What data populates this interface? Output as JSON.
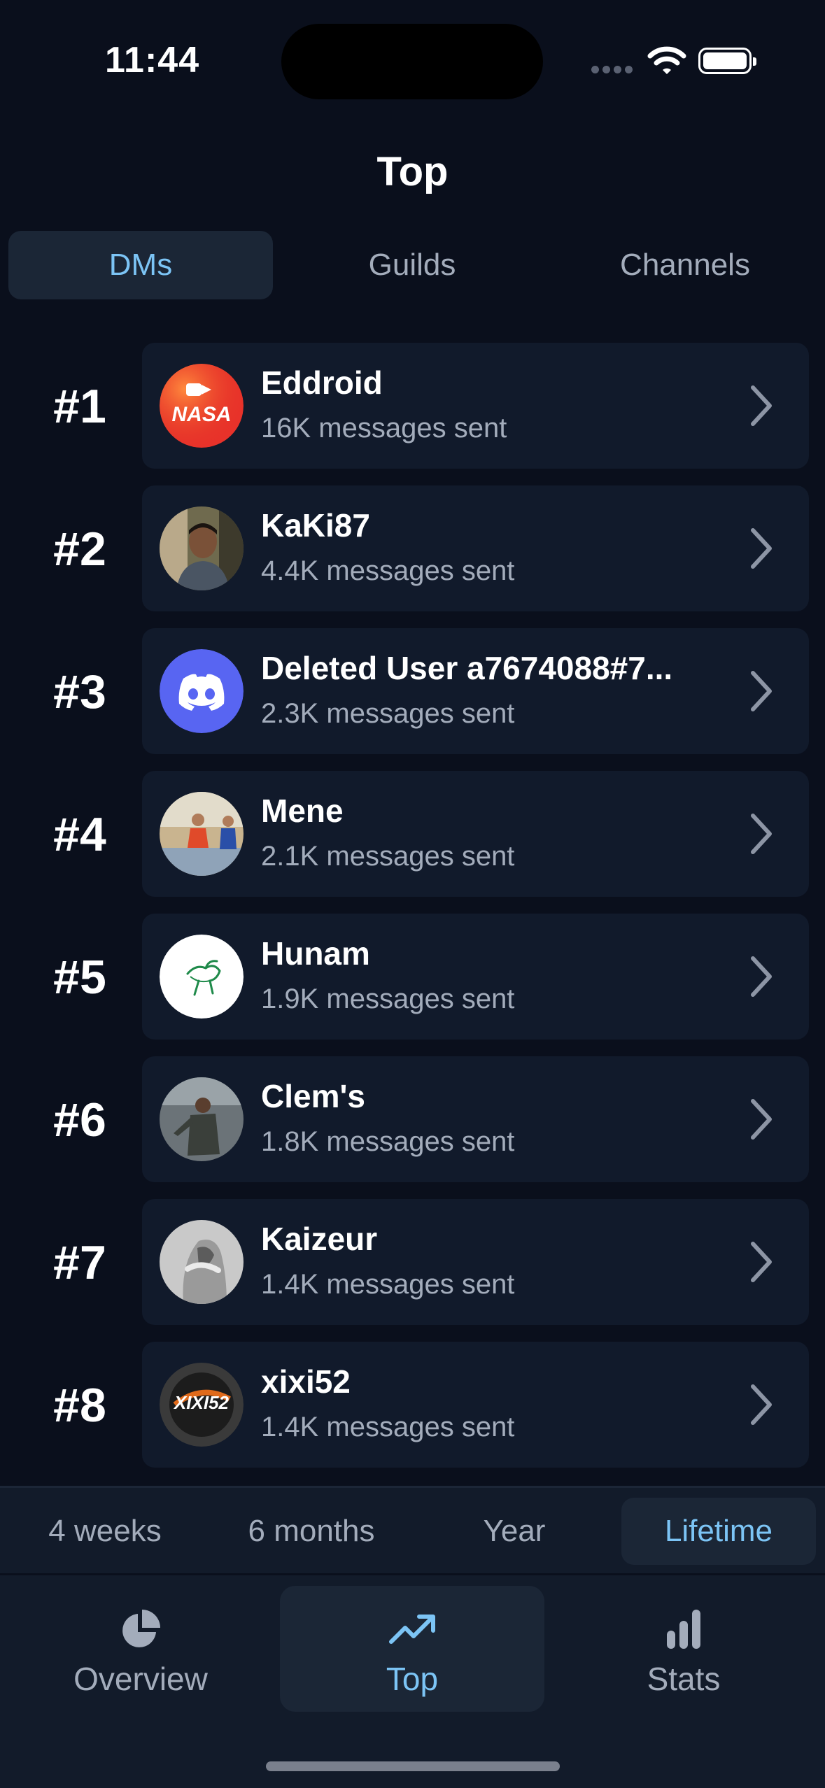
{
  "status": {
    "time": "11:44"
  },
  "header": {
    "title": "Top"
  },
  "segments": [
    {
      "label": "DMs",
      "active": true
    },
    {
      "label": "Guilds",
      "active": false
    },
    {
      "label": "Channels",
      "active": false
    }
  ],
  "rows": [
    {
      "rank": "#1",
      "name": "Eddroid",
      "sub": "16K messages sent",
      "avatar": "nasa-logo-avatar"
    },
    {
      "rank": "#2",
      "name": "KaKi87",
      "sub": "4.4K messages sent",
      "avatar": "person-photo-avatar"
    },
    {
      "rank": "#3",
      "name": "Deleted User a7674088#7...",
      "sub": "2.3K messages sent",
      "avatar": "discord-logo-avatar"
    },
    {
      "rank": "#4",
      "name": "Mene",
      "sub": "2.1K messages sent",
      "avatar": "sports-photo-avatar"
    },
    {
      "rank": "#5",
      "name": "Hunam",
      "sub": "1.9K messages sent",
      "avatar": "green-sketch-avatar"
    },
    {
      "rank": "#6",
      "name": "Clem's",
      "sub": "1.8K messages sent",
      "avatar": "movie-still-avatar"
    },
    {
      "rank": "#7",
      "name": "Kaizeur",
      "sub": "1.4K messages sent",
      "avatar": "hooded-figure-avatar"
    },
    {
      "rank": "#8",
      "name": "xixi52",
      "sub": "1.4K messages sent",
      "avatar": "xixi52-logo-avatar"
    }
  ],
  "periods": [
    {
      "label": "4 weeks",
      "active": false
    },
    {
      "label": "6 months",
      "active": false
    },
    {
      "label": "Year",
      "active": false
    },
    {
      "label": "Lifetime",
      "active": true
    }
  ],
  "tabbar": [
    {
      "label": "Overview",
      "icon": "pie-chart-icon",
      "active": false
    },
    {
      "label": "Top",
      "icon": "trending-up-icon",
      "active": true
    },
    {
      "label": "Stats",
      "icon": "bar-chart-icon",
      "active": false
    }
  ],
  "colors": {
    "accent": "#7cc4f5",
    "background": "#0a0f1c",
    "card": "#111a2b",
    "discord": "#5865f2"
  }
}
